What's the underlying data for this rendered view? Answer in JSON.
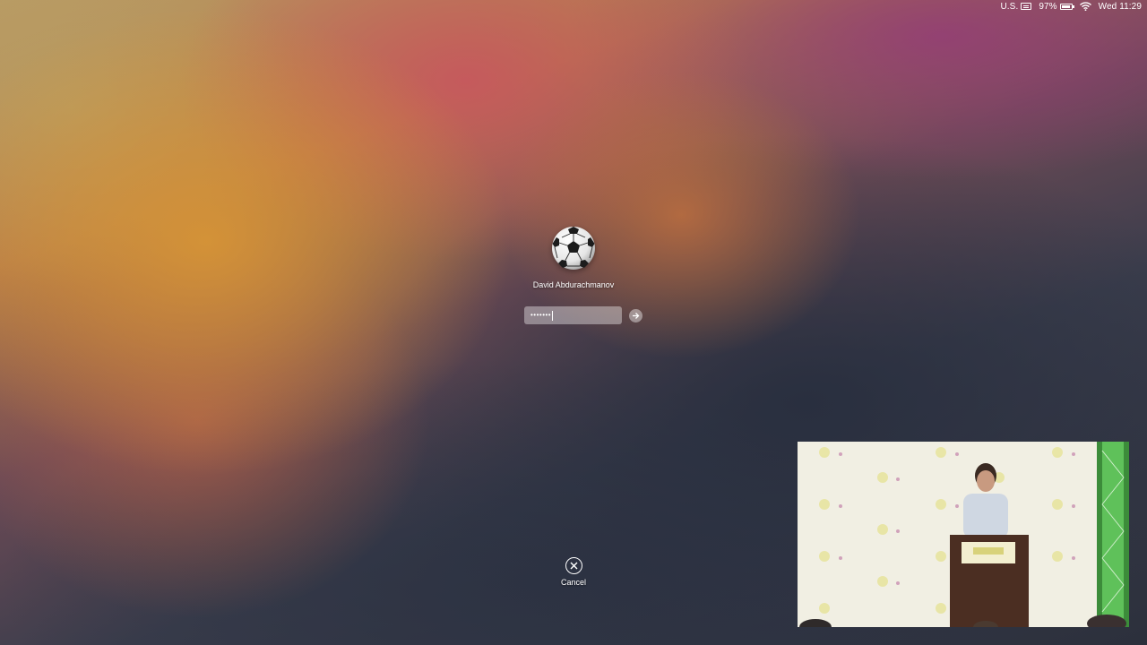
{
  "menubar": {
    "input_source": "U.S.",
    "battery_percent": "97%",
    "clock": "Wed 11:29",
    "icons": [
      "keyboard-icon",
      "battery-icon",
      "wifi-icon"
    ]
  },
  "login": {
    "username": "David Abdurachmanov",
    "password_mask": "•••••••",
    "avatar_icon": "soccer-ball-icon",
    "submit_icon": "arrow-right-icon"
  },
  "cancel": {
    "label": "Cancel",
    "icon": "close-circle-icon"
  },
  "video_overlay": {
    "backdrop_text": "Linaro"
  }
}
